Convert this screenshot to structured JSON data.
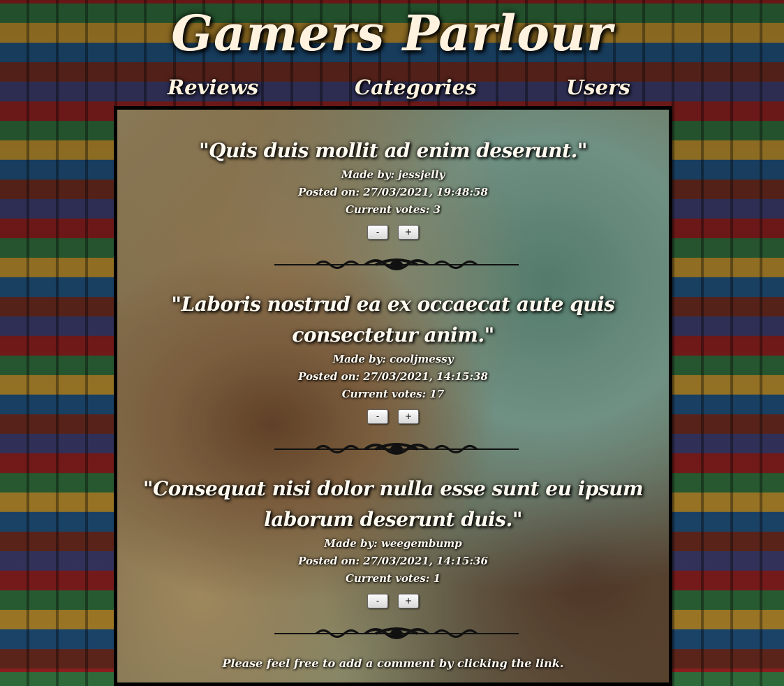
{
  "header": {
    "title": "Gamers Parlour"
  },
  "nav": {
    "reviews": "Reviews",
    "categories": "Categories",
    "users": "Users"
  },
  "reviews": [
    {
      "title": "\"Quis duis mollit ad enim deserunt.\"",
      "made_by": "Made by: jessjelly",
      "posted_on": "Posted on: 27/03/2021, 19:48:58",
      "votes": "Current votes: 3",
      "minus": "-",
      "plus": "+"
    },
    {
      "title": "\"Laboris nostrud ea ex occaecat aute quis consectetur anim.\"",
      "made_by": "Made by: cooljmessy",
      "posted_on": "Posted on: 27/03/2021, 14:15:38",
      "votes": "Current votes: 17",
      "minus": "-",
      "plus": "+"
    },
    {
      "title": "\"Consequat nisi dolor nulla esse sunt eu ipsum laborum deserunt duis.\"",
      "made_by": "Made by: weegembump",
      "posted_on": "Posted on: 27/03/2021, 14:15:36",
      "votes": "Current votes: 1",
      "minus": "-",
      "plus": "+"
    }
  ],
  "footer": {
    "note": "Please feel free to add a comment by clicking the link."
  }
}
